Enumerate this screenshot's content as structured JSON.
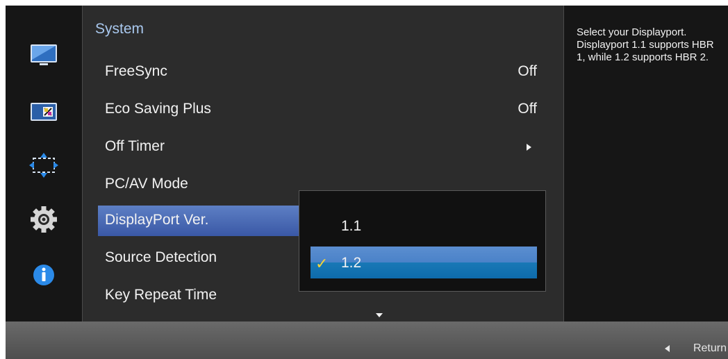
{
  "menu": {
    "title": "System",
    "items": [
      {
        "label": "FreeSync",
        "value": "Off"
      },
      {
        "label": "Eco Saving Plus",
        "value": "Off"
      },
      {
        "label": "Off Timer",
        "value": ""
      },
      {
        "label": "PC/AV Mode",
        "value": ""
      },
      {
        "label": "DisplayPort Ver.",
        "value": ""
      },
      {
        "label": "Source Detection",
        "value": ""
      },
      {
        "label": "Key Repeat Time",
        "value": ""
      }
    ],
    "selected_item": "DisplayPort Ver."
  },
  "dropdown": {
    "options": [
      "1.1",
      "1.2"
    ],
    "selected": "1.2"
  },
  "help": {
    "text": "Select your Displayport. Displayport 1.1 supports HBR 1, while 1.2 supports HBR 2."
  },
  "footer": {
    "return_label": "Return"
  },
  "side_icons": [
    "picture-icon",
    "color-icon",
    "size-position-icon",
    "system-gear-icon",
    "information-icon"
  ],
  "colors": {
    "title": "#a9c8ee",
    "highlight": "#3a58a6",
    "dropdown_selected": "#0e6bab",
    "check": "#f3d43a"
  }
}
